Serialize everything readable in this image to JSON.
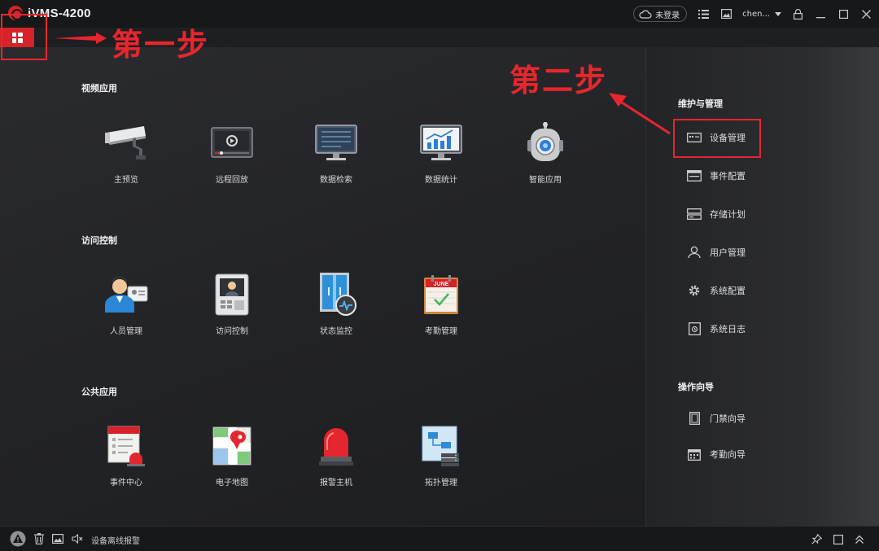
{
  "app": {
    "title": "iVMS-4200"
  },
  "titlebar": {
    "login_label": "未登录",
    "user_name": "chen..."
  },
  "sections": [
    {
      "title": "视频应用",
      "items": [
        {
          "label": "主预览",
          "icon": "camera-icon"
        },
        {
          "label": "远程回放",
          "icon": "playback-icon"
        },
        {
          "label": "数据检索",
          "icon": "data-search-icon"
        },
        {
          "label": "数据统计",
          "icon": "data-stats-icon"
        },
        {
          "label": "智能应用",
          "icon": "robot-icon"
        }
      ]
    },
    {
      "title": "访问控制",
      "items": [
        {
          "label": "人员管理",
          "icon": "person-card-icon"
        },
        {
          "label": "访问控制",
          "icon": "door-intercom-icon"
        },
        {
          "label": "状态监控",
          "icon": "door-status-icon"
        },
        {
          "label": "考勤管理",
          "icon": "calendar-icon"
        }
      ]
    },
    {
      "title": "公共应用",
      "items": [
        {
          "label": "事件中心",
          "icon": "event-center-icon"
        },
        {
          "label": "电子地图",
          "icon": "map-icon"
        },
        {
          "label": "报警主机",
          "icon": "alarm-light-icon"
        },
        {
          "label": "拓扑管理",
          "icon": "topology-icon"
        }
      ]
    }
  ],
  "calendar_month": "JUNE",
  "sidebar": {
    "maintenance": {
      "title": "维护与管理",
      "items": [
        {
          "label": "设备管理"
        },
        {
          "label": "事件配置"
        },
        {
          "label": "存储计划"
        },
        {
          "label": "用户管理"
        },
        {
          "label": "系统配置"
        },
        {
          "label": "系统日志"
        }
      ]
    },
    "guide": {
      "title": "操作向导",
      "items": [
        {
          "label": "门禁向导"
        },
        {
          "label": "考勤向导"
        }
      ]
    }
  },
  "statusbar": {
    "alarm_text": "设备离线报警"
  },
  "annotations": {
    "step1": "第一步",
    "step2": "第二步"
  },
  "colors": {
    "accent": "#d52329",
    "annotation": "#e8262d",
    "background": "#1e1f22"
  }
}
